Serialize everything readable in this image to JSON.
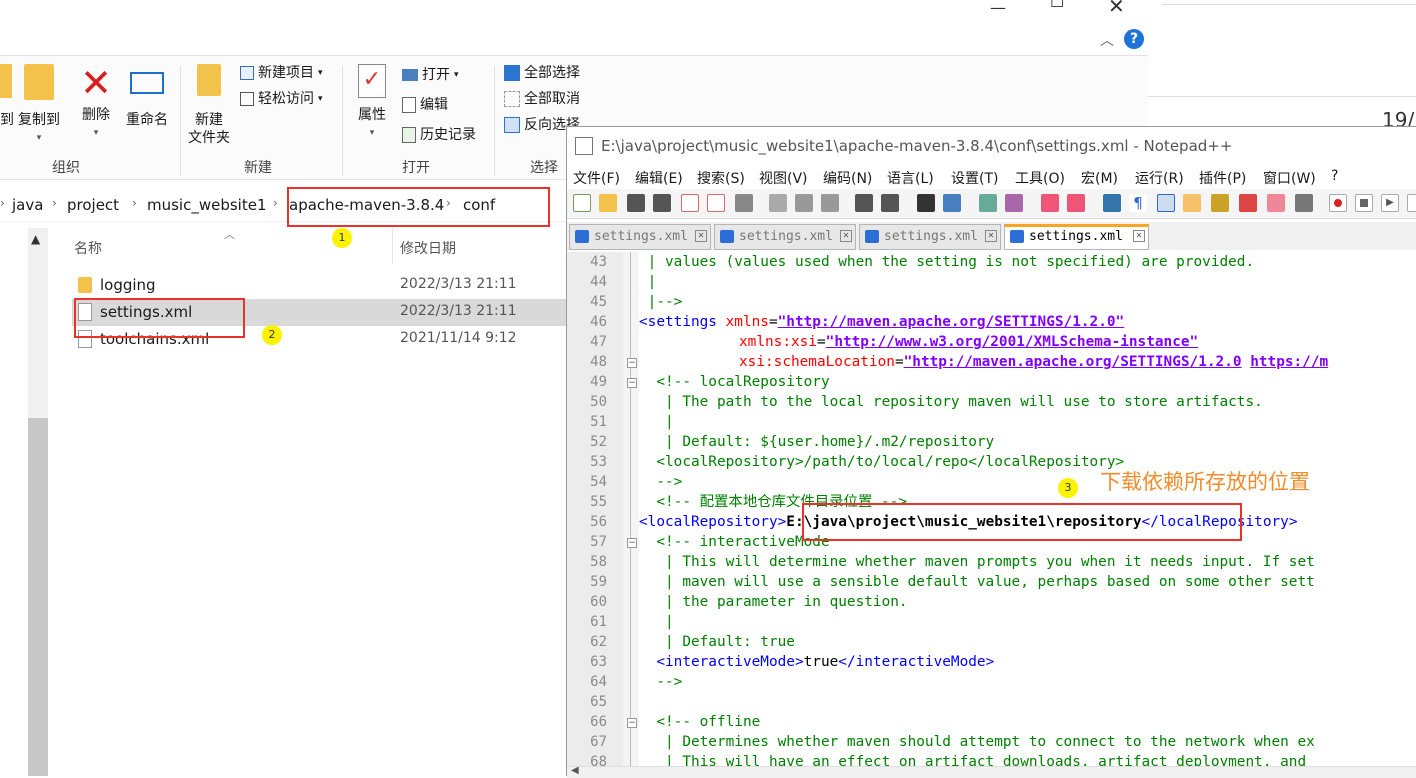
{
  "explorer": {
    "ribbon": {
      "copy_to_left": "到",
      "copy_to": "复制到",
      "delete": "删除",
      "rename": "重命名",
      "new_folder": "新建\n文件夹",
      "new_item": "新建项目",
      "easy_access": "轻松访问",
      "properties": "属性",
      "open": "打开",
      "edit": "编辑",
      "history": "历史记录",
      "select_all": "全部选择",
      "select_none": "全部取消",
      "invert_selection": "反向选择",
      "group_organize": "组织",
      "group_new": "新建",
      "group_open": "打开",
      "group_select": "选择"
    },
    "breadcrumb": [
      "java",
      "project",
      "music_website1",
      "apache-maven-3.8.4",
      "conf"
    ],
    "columns": {
      "name": "名称",
      "modified": "修改日期"
    },
    "files": [
      {
        "name": "logging",
        "date": "2022/3/13 21:11",
        "type": "folder"
      },
      {
        "name": "settings.xml",
        "date": "2022/3/13 21:11",
        "type": "file"
      },
      {
        "name": "toolchains.xml",
        "date": "2021/11/14 9:12",
        "type": "file"
      }
    ],
    "markers": [
      "1",
      "2"
    ],
    "partial_right_text": "19/"
  },
  "notepad": {
    "title": "E:\\java\\project\\music_website1\\apache-maven-3.8.4\\conf\\settings.xml - Notepad++",
    "menu": [
      "文件(F)",
      "编辑(E)",
      "搜索(S)",
      "视图(V)",
      "编码(N)",
      "语言(L)",
      "设置(T)",
      "工具(O)",
      "宏(M)",
      "运行(R)",
      "插件(P)",
      "窗口(W)",
      "?"
    ],
    "tabs": [
      "settings.xml",
      "settings.xml",
      "settings.xml",
      "settings.xml"
    ],
    "line_numbers": [
      "43",
      "44",
      "45",
      "46",
      "47",
      "48",
      "49",
      "50",
      "51",
      "52",
      "53",
      "54",
      "55",
      "56",
      "57",
      "58",
      "59",
      "60",
      "61",
      "62",
      "63",
      "64",
      "65",
      "66",
      "67",
      "68"
    ],
    "lines": {
      "l43": " | values (values used when the setting is not specified) are provided.",
      "l44": " |",
      "l45": " |-->",
      "l46_tag": "<settings ",
      "l46_attr": "xmlns",
      "l46_eq": "=",
      "l46_val": "\"http://maven.apache.org/SETTINGS/1.2.0\"",
      "l47_attr": "xmlns:xsi",
      "l47_val": "\"http://www.w3.org/2001/XMLSchema-instance\"",
      "l48_attr": "xsi:schemaLocation",
      "l48_val1": "\"http://maven.apache.org/SETTINGS/1.2.0",
      "l48_val2": "https://m",
      "l49": "  <!-- localRepository",
      "l50": "   | The path to the local repository maven will use to store artifacts.",
      "l51": "   |",
      "l52": "   | Default: ${user.home}/.m2/repository",
      "l53": "  <localRepository>/path/to/local/repo</localRepository>",
      "l54": "  -->",
      "l55": "  <!-- 配置本地仓库文件目录位置 -->",
      "l56_open": "<localRepository>",
      "l56_val": "E:\\java\\project\\music_website1\\repository",
      "l56_close": "</localRepository>",
      "l57": "  <!-- interactiveMode",
      "l58": "   | This will determine whether maven prompts you when it needs input. If set",
      "l59": "   | maven will use a sensible default value, perhaps based on some other sett",
      "l60": "   | the parameter in question.",
      "l61": "   |",
      "l62": "   | Default: true",
      "l63_open": "  <interactiveMode>",
      "l63_val": "true",
      "l63_close": "</interactiveMode>",
      "l64": "  -->",
      "l65": "",
      "l66": "  <!-- offline",
      "l67": "   | Determines whether maven should attempt to connect to the network when ex",
      "l68": "   | This will have an effect on artifact downloads, artifact deployment, and"
    },
    "marker": "3",
    "annotation": "下载依赖所存放的位置"
  },
  "colors": {
    "highlight_box": "#e8322b",
    "marker": "#fbf200",
    "annotation": "#f28c28",
    "tab_accent": "#f6a524"
  }
}
